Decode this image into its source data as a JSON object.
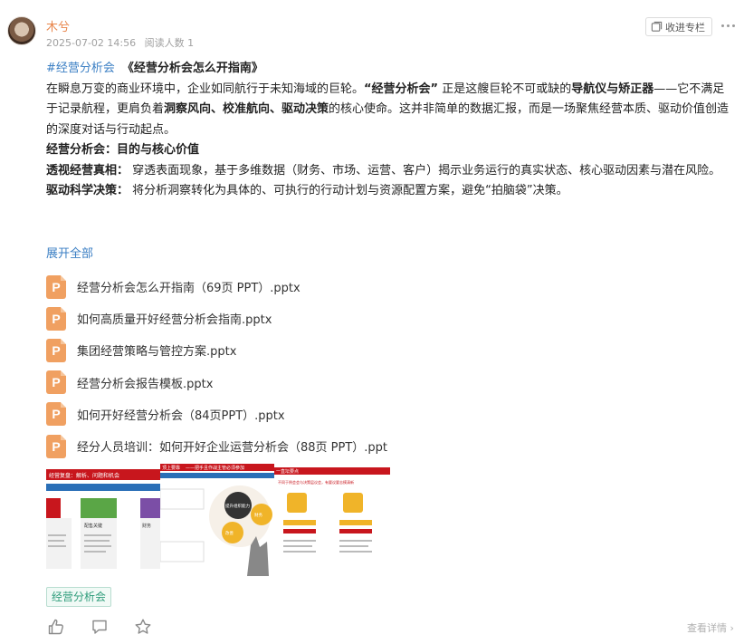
{
  "author": {
    "name": "木兮"
  },
  "meta": {
    "date": "2025-07-02 14:56",
    "views": "阅读人数 1"
  },
  "toolbar": {
    "collect_label": "收进专栏"
  },
  "post": {
    "hashtag": "#经营分析会",
    "title": "《经营分析会怎么开指南》",
    "p1_a": "在瞬息万变的商业环境中，企业如同航行于未知海域的巨轮。",
    "p1_b": "“经营分析会”",
    "p1_c": " 正是这艘巨轮不可或缺的",
    "p1_d": "导航仪与矫正器",
    "p1_e": "——它不满足于记录航程，更肩负着",
    "p1_f": "洞察风向、校准航向、驱动决策",
    "p1_g": "的核心使命。这并非简单的数据汇报，而是一场聚焦经营本质、驱动价值创造的深度对话与行动起点。",
    "heading": "经营分析会：目的与核心价值",
    "item1_label": "透视经营真相：",
    "item1_text": " 穿透表面现象，基于多维数据（财务、市场、运营、客户）揭示业务运行的真实状态、核心驱动因素与潜在风险。",
    "item2_label": "驱动科学决策：",
    "item2_text": " 将分析洞察转化为具体的、可执行的行动计划与资源配置方案，避免“拍脑袋”决策。",
    "expand": "展开全部"
  },
  "files": [
    {
      "name": "经营分析会怎么开指南（69页 PPT）.pptx",
      "icon": "P"
    },
    {
      "name": "如何高质量开好经营分析会指南.pptx",
      "icon": "P"
    },
    {
      "name": "集团经营策略与管控方案.pptx",
      "icon": "P"
    },
    {
      "name": "经营分析会报告模板.pptx",
      "icon": "P"
    },
    {
      "name": "如何开好经营分析会（84页PPT）.pptx",
      "icon": "P"
    },
    {
      "name": "经分人员培训：如何开好企业运营分析会（88页 PPT）.ppt",
      "icon": "P"
    }
  ],
  "thumbnails": [
    {
      "texts": [
        "经营复盘：解析、问题和机会",
        "配售关键",
        "财务"
      ]
    },
    {
      "texts": [
        "顶上要靠",
        "——把手且作战主管必须参加",
        "提升组织能力",
        "财务",
        "改善"
      ]
    },
    {
      "texts": [
        "一直坛要点",
        "不同于例会会与决策层议会，有要议要志摸清新"
      ]
    }
  ],
  "tag": "经营分析会",
  "footer": {
    "detail": "查看详情"
  },
  "colors": {
    "accent": "#3b7fc4",
    "author": "#e8854a",
    "file_icon": "#f0a061",
    "tag": "#2e9c7a",
    "slide_red": "#c8161d"
  }
}
